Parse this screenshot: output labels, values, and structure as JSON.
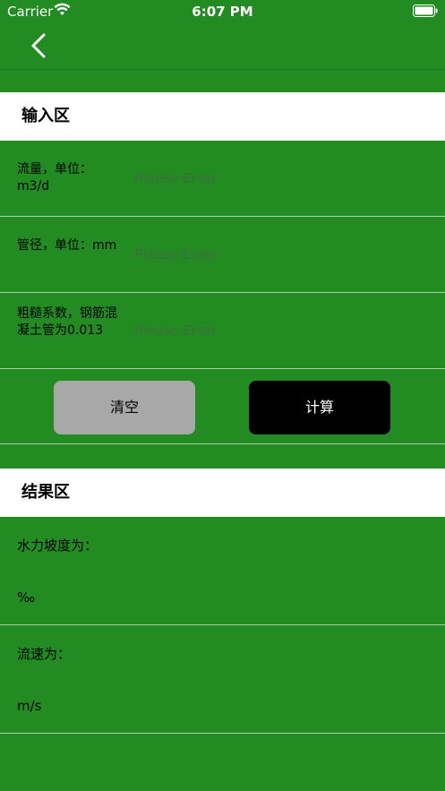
{
  "status_bar": {
    "carrier": "Carrier",
    "time": "6:07 PM"
  },
  "nav": {
    "back_icon": "chevron-left-icon"
  },
  "input_section": {
    "title": "输入区",
    "fields": [
      {
        "label": "流量，单位：m3/d",
        "placeholder": "Please Enter",
        "value": ""
      },
      {
        "label": "管径，单位：mm",
        "placeholder": "Please Enter",
        "value": ""
      },
      {
        "label": "粗糙系数，钢筋混凝土管为0.013",
        "placeholder": "Please Enter",
        "value": ""
      }
    ]
  },
  "buttons": {
    "clear_label": "清空",
    "calculate_label": "计算"
  },
  "result_section": {
    "title": "结果区",
    "results": [
      {
        "label": "水力坡度为：",
        "unit": "‰"
      },
      {
        "label": "流速为：",
        "unit": "m/s"
      }
    ]
  },
  "colors": {
    "background": "#228B22",
    "header_bg": "#FFFFFF",
    "clear_button": "#A8A8A8",
    "calculate_button": "#000000"
  }
}
